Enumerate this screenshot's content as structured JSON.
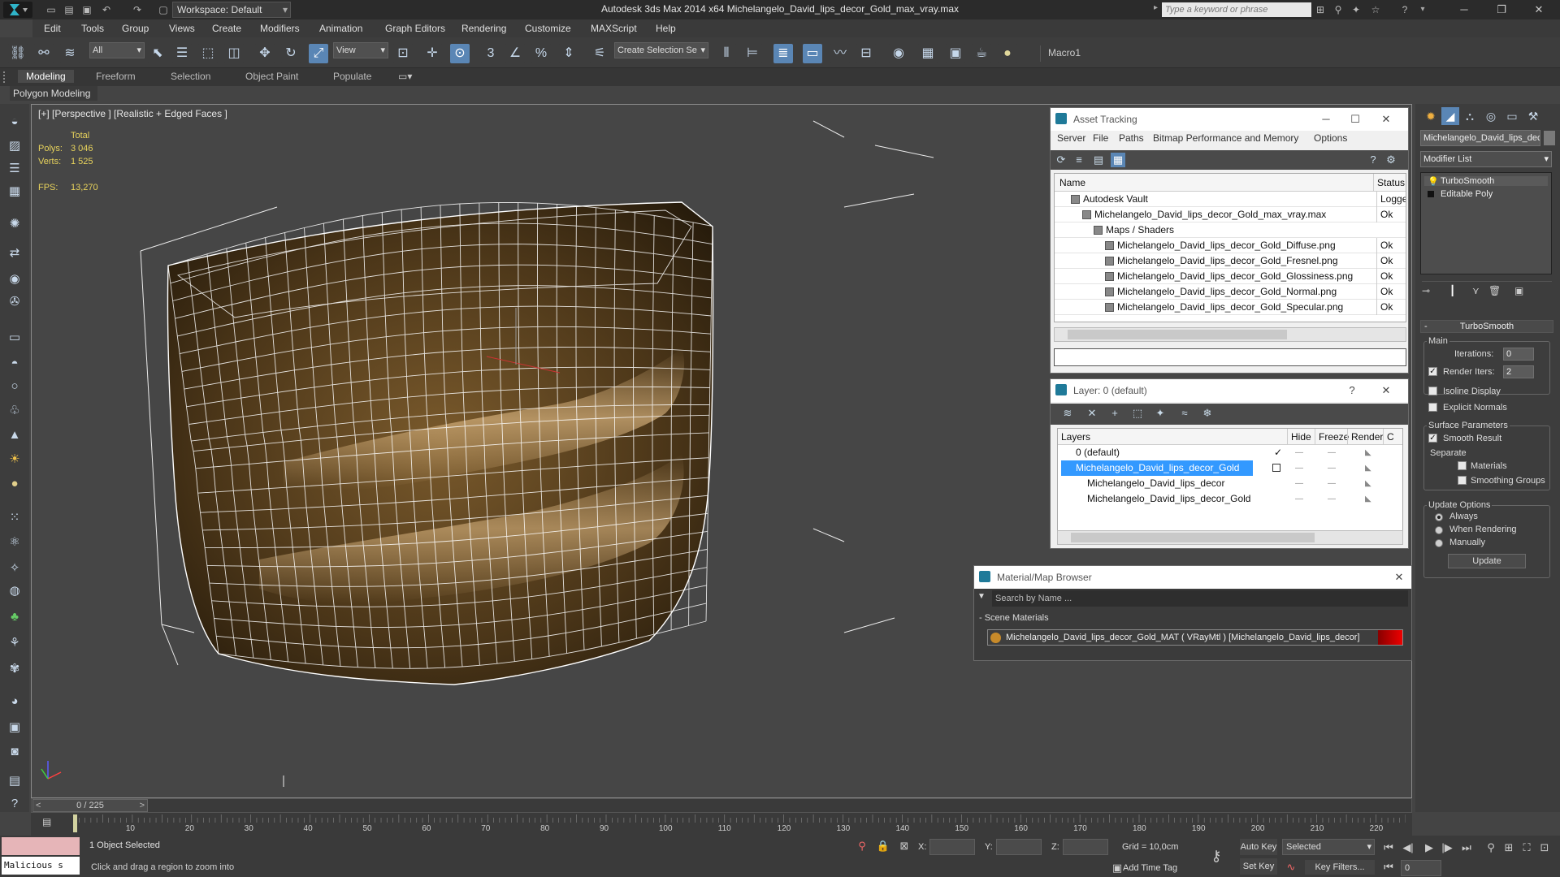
{
  "title_bar": {
    "workspace": "Workspace: Default",
    "app_title": "Autodesk 3ds Max  2014 x64      Michelangelo_David_lips_decor_Gold_max_vray.max",
    "search_placeholder": "Type a keyword or phrase"
  },
  "menu": [
    "Edit",
    "Tools",
    "Group",
    "Views",
    "Create",
    "Modifiers",
    "Animation",
    "Graph Editors",
    "Rendering",
    "Customize",
    "MAXScript",
    "Help"
  ],
  "toolbar": {
    "filter": "All",
    "ref_coord": "View",
    "selection_set": "Create Selection Se",
    "macro": "Macro1"
  },
  "ribbon": {
    "tabs": [
      "Modeling",
      "Freeform",
      "Selection",
      "Object Paint",
      "Populate"
    ],
    "active": "Modeling",
    "panel": "Polygon Modeling"
  },
  "viewport": {
    "label": "[+] [Perspective ] [Realistic + Edged Faces ]",
    "stats": {
      "total": "Total",
      "polys_label": "Polys:",
      "polys": "3 046",
      "verts_label": "Verts:",
      "verts": "1 525",
      "fps_label": "FPS:",
      "fps": "13,270"
    }
  },
  "asset_tracking": {
    "title": "Asset Tracking",
    "menu": [
      "Server",
      "File",
      "Paths",
      "Bitmap Performance and Memory",
      "Options"
    ],
    "col_name": "Name",
    "col_status": "Status",
    "rows": [
      {
        "name": "Autodesk Vault",
        "status": "Logged",
        "indent": 1
      },
      {
        "name": "Michelangelo_David_lips_decor_Gold_max_vray.max",
        "status": "Ok",
        "indent": 2
      },
      {
        "name": "Maps / Shaders",
        "status": "",
        "indent": 3
      },
      {
        "name": "Michelangelo_David_lips_decor_Gold_Diffuse.png",
        "status": "Ok",
        "indent": 4
      },
      {
        "name": "Michelangelo_David_lips_decor_Gold_Fresnel.png",
        "status": "Ok",
        "indent": 4
      },
      {
        "name": "Michelangelo_David_lips_decor_Gold_Glossiness.png",
        "status": "Ok",
        "indent": 4
      },
      {
        "name": "Michelangelo_David_lips_decor_Gold_Normal.png",
        "status": "Ok",
        "indent": 4
      },
      {
        "name": "Michelangelo_David_lips_decor_Gold_Specular.png",
        "status": "Ok",
        "indent": 4
      }
    ]
  },
  "layers": {
    "title": "Layer: 0 (default)",
    "help": "?",
    "cols": [
      "Layers",
      "Hide",
      "Freeze",
      "Render",
      "C"
    ],
    "rows": [
      {
        "name": "0 (default)",
        "selected": false,
        "indent": 1
      },
      {
        "name": "Michelangelo_David_lips_decor_Gold",
        "selected": true,
        "indent": 1
      },
      {
        "name": "Michelangelo_David_lips_decor",
        "selected": false,
        "indent": 2
      },
      {
        "name": "Michelangelo_David_lips_decor_Gold",
        "selected": false,
        "indent": 2
      }
    ]
  },
  "material_browser": {
    "title": "Material/Map Browser",
    "search_placeholder": "Search by Name ...",
    "group": "- Scene Materials",
    "item": "Michelangelo_David_lips_decor_Gold_MAT ( VRayMtl ) [Michelangelo_David_lips_decor]"
  },
  "command_panel": {
    "object_name": "Michelangelo_David_lips_deco",
    "modifier_list": "Modifier List",
    "stack": [
      "TurboSmooth",
      "Editable Poly"
    ],
    "rollout": "TurboSmooth",
    "main": "Main",
    "iterations_label": "Iterations:",
    "iterations": "0",
    "render_iters_label": "Render Iters:",
    "render_iters": "2",
    "isoline": "Isoline Display",
    "explicit": "Explicit Normals",
    "surface": "Surface Parameters",
    "smooth_result": "Smooth Result",
    "separate": "Separate",
    "materials": "Materials",
    "smoothing_groups": "Smoothing Groups",
    "update_options": "Update Options",
    "always": "Always",
    "when_rendering": "When Rendering",
    "manually": "Manually",
    "update_btn": "Update"
  },
  "timeline": {
    "frame": "0 / 225",
    "ticks": [
      "10",
      "20",
      "30",
      "40",
      "50",
      "60",
      "70",
      "80",
      "90",
      "100",
      "110",
      "120",
      "130",
      "140",
      "150",
      "160",
      "170",
      "180",
      "190",
      "200",
      "210",
      "220"
    ]
  },
  "status": {
    "maxscript": "Malicious s",
    "selected": "1 Object Selected",
    "prompt": "Click and drag a region to zoom into",
    "x_label": "X:",
    "y_label": "Y:",
    "z_label": "Z:",
    "grid": "Grid = 10,0cm",
    "auto_key": "Auto Key",
    "set_key": "Set Key",
    "key_mode": "Selected",
    "key_filters": "Key Filters...",
    "add_time_tag": "Add Time Tag",
    "frame_field": "0"
  },
  "colors": {
    "accent": "#5a86b5",
    "selection": "#3399ff",
    "wire": "#ffffff"
  }
}
